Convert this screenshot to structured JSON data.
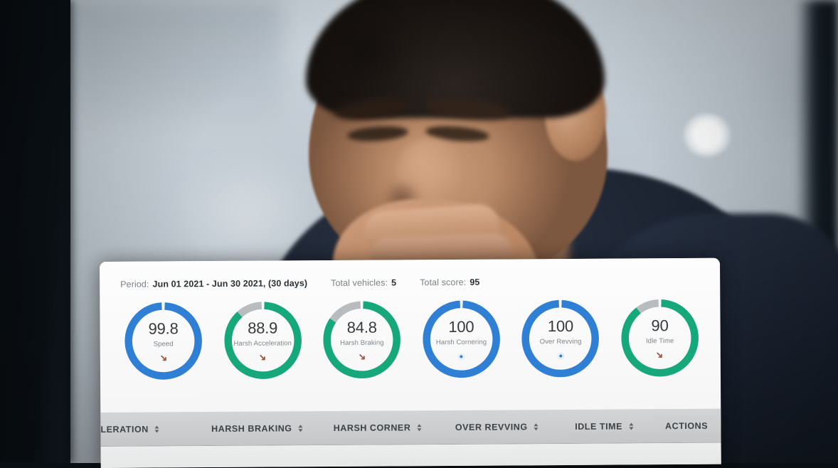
{
  "scene": {
    "description": "blurred office photo background with a seated man resting hand on chin",
    "subject": "man-thinking",
    "bokeh_light": "ceiling-light-bokeh"
  },
  "colors": {
    "blue": "#2f7fd4",
    "green": "#16a87a",
    "track_grey": "#b9bcbf",
    "card_bg": "#fbfbfb",
    "header_bg": "#cbcdcf",
    "trend_down": "#9c5a45"
  },
  "summary": {
    "period_label": "Period:",
    "period_value": "Jun 01 2021 - Jun 30 2021, (30 days)",
    "total_vehicles_label": "Total vehicles:",
    "total_vehicles_value": "5",
    "total_score_label": "Total score:",
    "total_score_value": "95"
  },
  "gauges": [
    {
      "value": "99.8",
      "percent": 99.8,
      "label": "Speed",
      "color": "#2f7fd4",
      "trend": "down"
    },
    {
      "value": "88.9",
      "percent": 88.9,
      "label": "Harsh Acceleration",
      "color": "#16a87a",
      "trend": "down"
    },
    {
      "value": "84.8",
      "percent": 84.8,
      "label": "Harsh Braking",
      "color": "#16a87a",
      "trend": "down"
    },
    {
      "value": "100",
      "percent": 100,
      "label": "Harsh Cornering",
      "color": "#2f7fd4",
      "trend": "flat"
    },
    {
      "value": "100",
      "percent": 100,
      "label": "Over Revving",
      "color": "#2f7fd4",
      "trend": "flat"
    },
    {
      "value": "90",
      "percent": 90,
      "label": "Idle Time",
      "color": "#16a87a",
      "trend": "down"
    }
  ],
  "table": {
    "columns": [
      {
        "label": "LERATION",
        "sortable": true,
        "truncated": true
      },
      {
        "label": "HARSH BRAKING",
        "sortable": true,
        "truncated": false
      },
      {
        "label": "HARSH CORNER",
        "sortable": true,
        "truncated": false
      },
      {
        "label": "OVER REVVING",
        "sortable": true,
        "truncated": false
      },
      {
        "label": "IDLE TIME",
        "sortable": true,
        "truncated": false
      },
      {
        "label": "ACTIONS",
        "sortable": false,
        "truncated": false
      }
    ]
  }
}
